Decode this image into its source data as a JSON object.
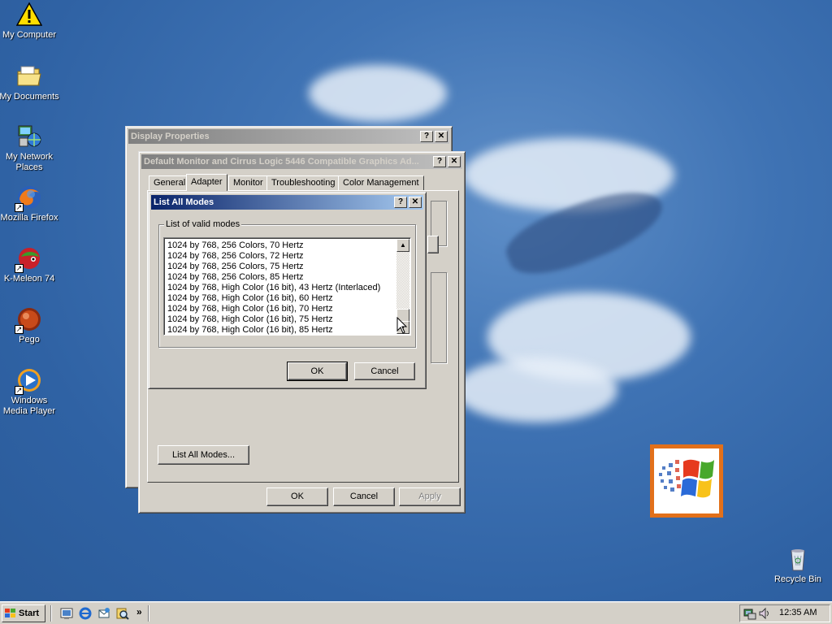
{
  "desktop": {
    "icons": [
      {
        "label": "My Computer",
        "icon": "warning-icon"
      },
      {
        "label": "My Documents",
        "icon": "folder-icon"
      },
      {
        "label": "My Network Places",
        "icon": "network-icon"
      },
      {
        "label": "Mozilla Firefox",
        "icon": "firefox-icon"
      },
      {
        "label": "K-Meleon 74",
        "icon": "k-meleon-icon"
      },
      {
        "label": "Pego",
        "icon": "pego-icon"
      },
      {
        "label": "Windows Media Player",
        "icon": "media-player-icon"
      },
      {
        "label": "Recycle Bin",
        "icon": "recycle-bin-icon"
      }
    ]
  },
  "display_properties": {
    "title": "Display Properties",
    "help": "?",
    "close": "✕"
  },
  "monitor_dialog": {
    "title": "Default Monitor and Cirrus Logic 5446 Compatible Graphics Ad...",
    "help": "?",
    "close": "✕",
    "tabs": [
      "General",
      "Adapter",
      "Monitor",
      "Troubleshooting",
      "Color Management"
    ],
    "selected_tab": "Adapter",
    "list_all_modes_button": "List All Modes...",
    "ok": "OK",
    "cancel": "Cancel",
    "apply": "Apply"
  },
  "list_modes_dialog": {
    "title": "List All Modes",
    "help": "?",
    "close": "✕",
    "group_label": "List of valid modes",
    "modes": [
      "1024 by 768, 256 Colors, 70 Hertz",
      "1024 by 768, 256 Colors, 72 Hertz",
      "1024 by 768, 256 Colors, 75 Hertz",
      "1024 by 768, 256 Colors, 85 Hertz",
      "1024 by 768, High Color (16 bit), 43 Hertz (Interlaced)",
      "1024 by 768, High Color (16 bit), 60 Hertz",
      "1024 by 768, High Color (16 bit), 70 Hertz",
      "1024 by 768, High Color (16 bit), 75 Hertz",
      "1024 by 768, High Color (16 bit), 85 Hertz"
    ],
    "ok": "OK",
    "cancel": "Cancel"
  },
  "taskbar": {
    "start_label": "Start",
    "clock": "12:35 AM",
    "more_chevron": "»"
  },
  "colors": {
    "desktop": "#3a6eb0",
    "titlebar_active": "#0a246a",
    "face": "#d4d0c8"
  }
}
